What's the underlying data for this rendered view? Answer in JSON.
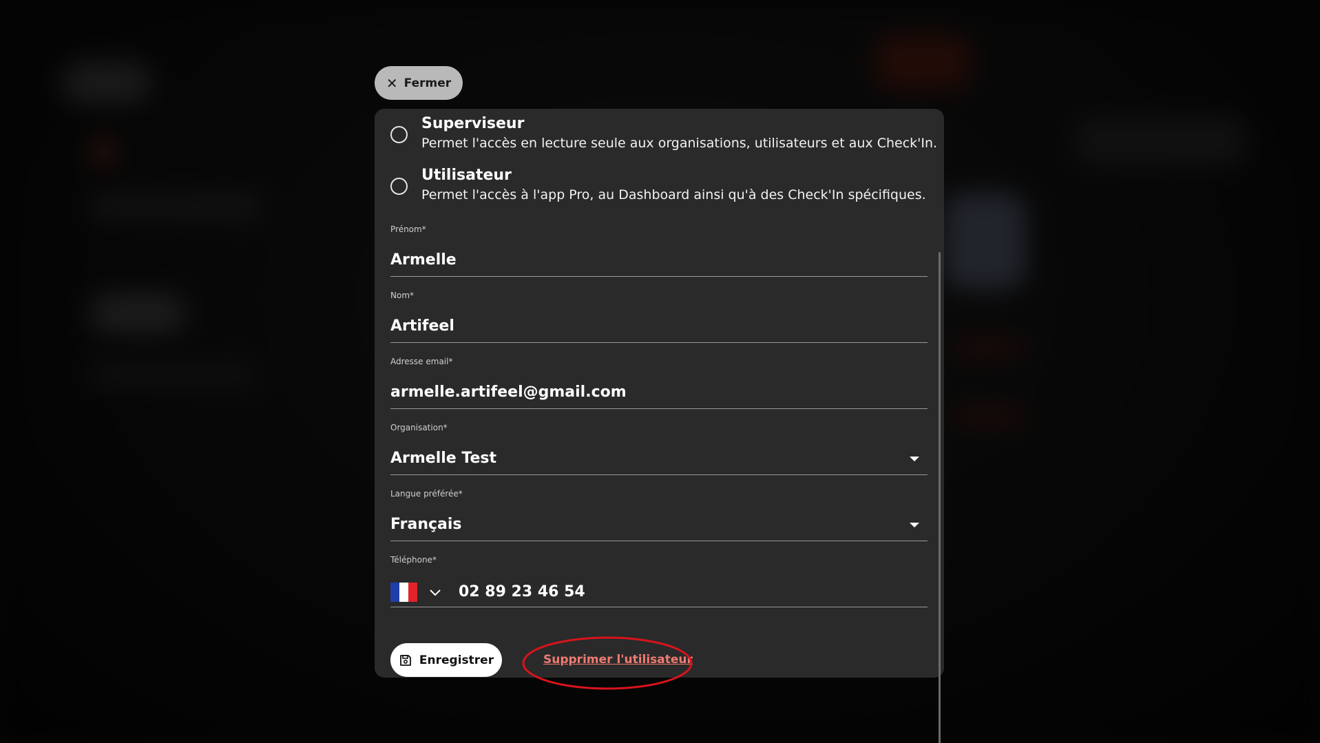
{
  "close_button": {
    "label": "Fermer"
  },
  "roles": [
    {
      "title": "Superviseur",
      "description": "Permet l'accès en lecture seule aux organisations, utilisateurs et aux Check'In."
    },
    {
      "title": "Utilisateur",
      "description": "Permet l'accès à l'app Pro, au Dashboard ainsi qu'à des Check'In spécifiques."
    }
  ],
  "form": {
    "first_name": {
      "label": "Prénom*",
      "value": "Armelle"
    },
    "last_name": {
      "label": "Nom*",
      "value": "Artifeel"
    },
    "email": {
      "label": "Adresse email*",
      "value": "armelle.artifeel@gmail.com"
    },
    "organisation": {
      "label": "Organisation*",
      "value": "Armelle Test"
    },
    "language": {
      "label": "Langue préférée*",
      "value": "Français"
    },
    "phone": {
      "label": "Téléphone*",
      "value": "02 89 23 46 54",
      "country_icon": "flag-france-icon"
    }
  },
  "actions": {
    "save_label": "Enregistrer",
    "delete_label": "Supprimer l'utilisateur"
  },
  "colors": {
    "modal_bg": "#2a2a2a",
    "delete_link": "#ef7b72",
    "highlight": "#d8141c",
    "close_button_bg": "#b9b9b9"
  }
}
